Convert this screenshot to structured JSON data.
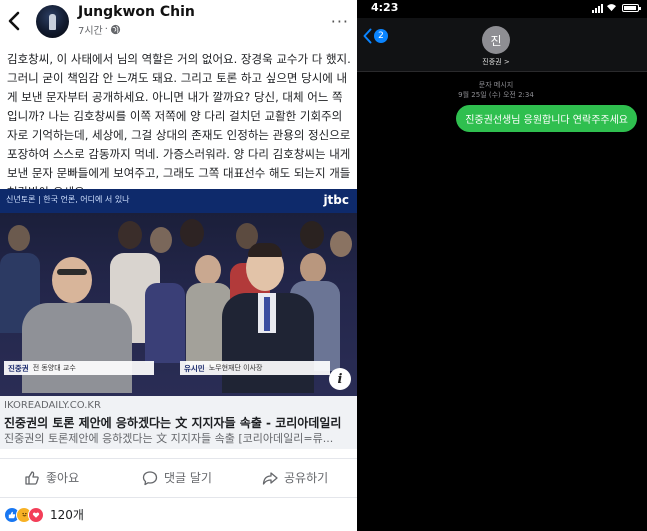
{
  "facebook": {
    "author": "Jungkwon Chin",
    "time": "7시간",
    "post_text": "김호창씨, 이 사태에서 님의 역할은 거의 없어요. 장경욱 교수가 다 했지.\n그러니 굳이 책임감 안 느껴도 돼요. 그리고 토론 하고 싶으면 당시에 내\n게 보낸 문자부터 공개하세요. 아니면 내가 깔까요?  당신, 대체 어느 쪽\n입니까?  나는 김호창씨를 이쪽 저쪽에 양 다리 걸치던 교활한 기회주의\n자로 기억하는데, 세상에, 그걸 상대의 존재도 인정하는 관용의 정신으로\n포장하여 스스로 감동까지 먹네. 가증스러워라. 양 다리 김호창씨는 내게\n보낸 문자 문빠들에게 보여주고, 그래도 그쪽 대표선수 해도 되는지 개들\n허락받아 오세요.",
    "image": {
      "top_tag": "신년토론 | 한국 언론, 어디에 서 있나",
      "channel": "jtbc",
      "left_caption_name": "진중권",
      "left_caption_role": "전 동양대 교수",
      "right_caption_name": "유시민",
      "right_caption_role": "노무현재단 이사장"
    },
    "link": {
      "domain": "IKOREADAILY.CO.KR",
      "title": "진중권의 토론 제안에 응하겠다는 文 지지자들 속출 - 코리아데일리",
      "description": "진중권의 토론제안에 응하겠다는 文 지지자들 속출 [코리아데일리=류..."
    },
    "actions": {
      "like": "좋아요",
      "comment": "댓글 달기",
      "share": "공유하기"
    },
    "reaction_count": "120개",
    "colors": {
      "like_blue": "#1877f2",
      "haha_yellow": "#f7b125",
      "love_red": "#f33e58"
    }
  },
  "imessage": {
    "status_time": "4:23",
    "back_badge": "2",
    "contact_initial": "진",
    "contact_name": "진중권 >",
    "message_type": "문자 메시지",
    "message_date": "9월 25일 (수) 오전 2:34",
    "message": "진중권선생님 응원합니다 연락주주세요",
    "colors": {
      "bubble_green": "#2fbf4f",
      "badge_blue": "#0a84ff"
    }
  }
}
